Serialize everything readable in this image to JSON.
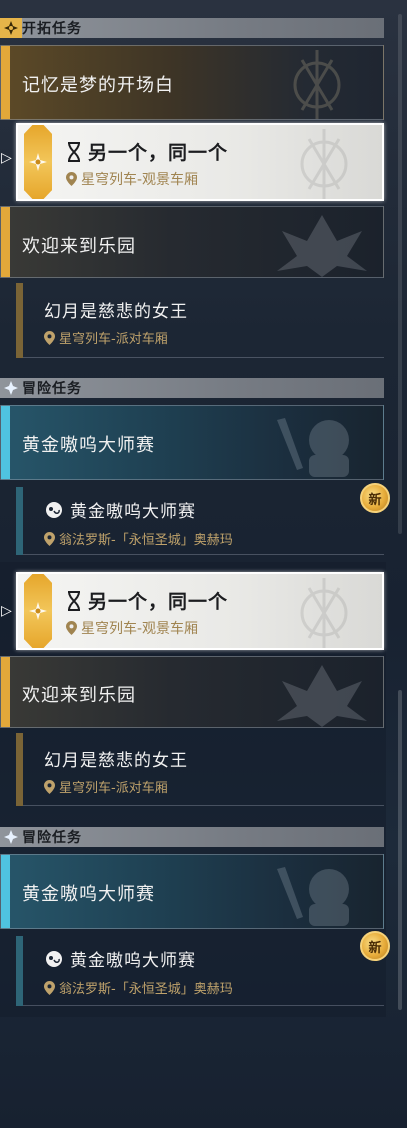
{
  "sections": {
    "main": {
      "label": "开拓任务"
    },
    "adventure": {
      "label": "冒险任务"
    }
  },
  "quests": {
    "memory": {
      "title": "记忆是梦的开场白"
    },
    "selected": {
      "title": "另一个，同一个",
      "location": "星穹列车-观景车厢"
    },
    "welcome": {
      "title": "欢迎来到乐园"
    },
    "illusion": {
      "title": "幻月是慈悲的女王",
      "location": "星穹列车-派对车厢"
    },
    "golden_group": {
      "title": "黄金嗷呜大师赛"
    },
    "golden_sub": {
      "title": "黄金嗷呜大师赛",
      "location": "翁法罗斯-「永恒圣城」奥赫玛"
    }
  },
  "badges": {
    "new": "新"
  },
  "colors": {
    "accent_gold": "#e2a83a",
    "accent_cyan": "#4fc3e0",
    "location_text": "#bfa26b",
    "selected_bg": "#f5f5f3"
  }
}
